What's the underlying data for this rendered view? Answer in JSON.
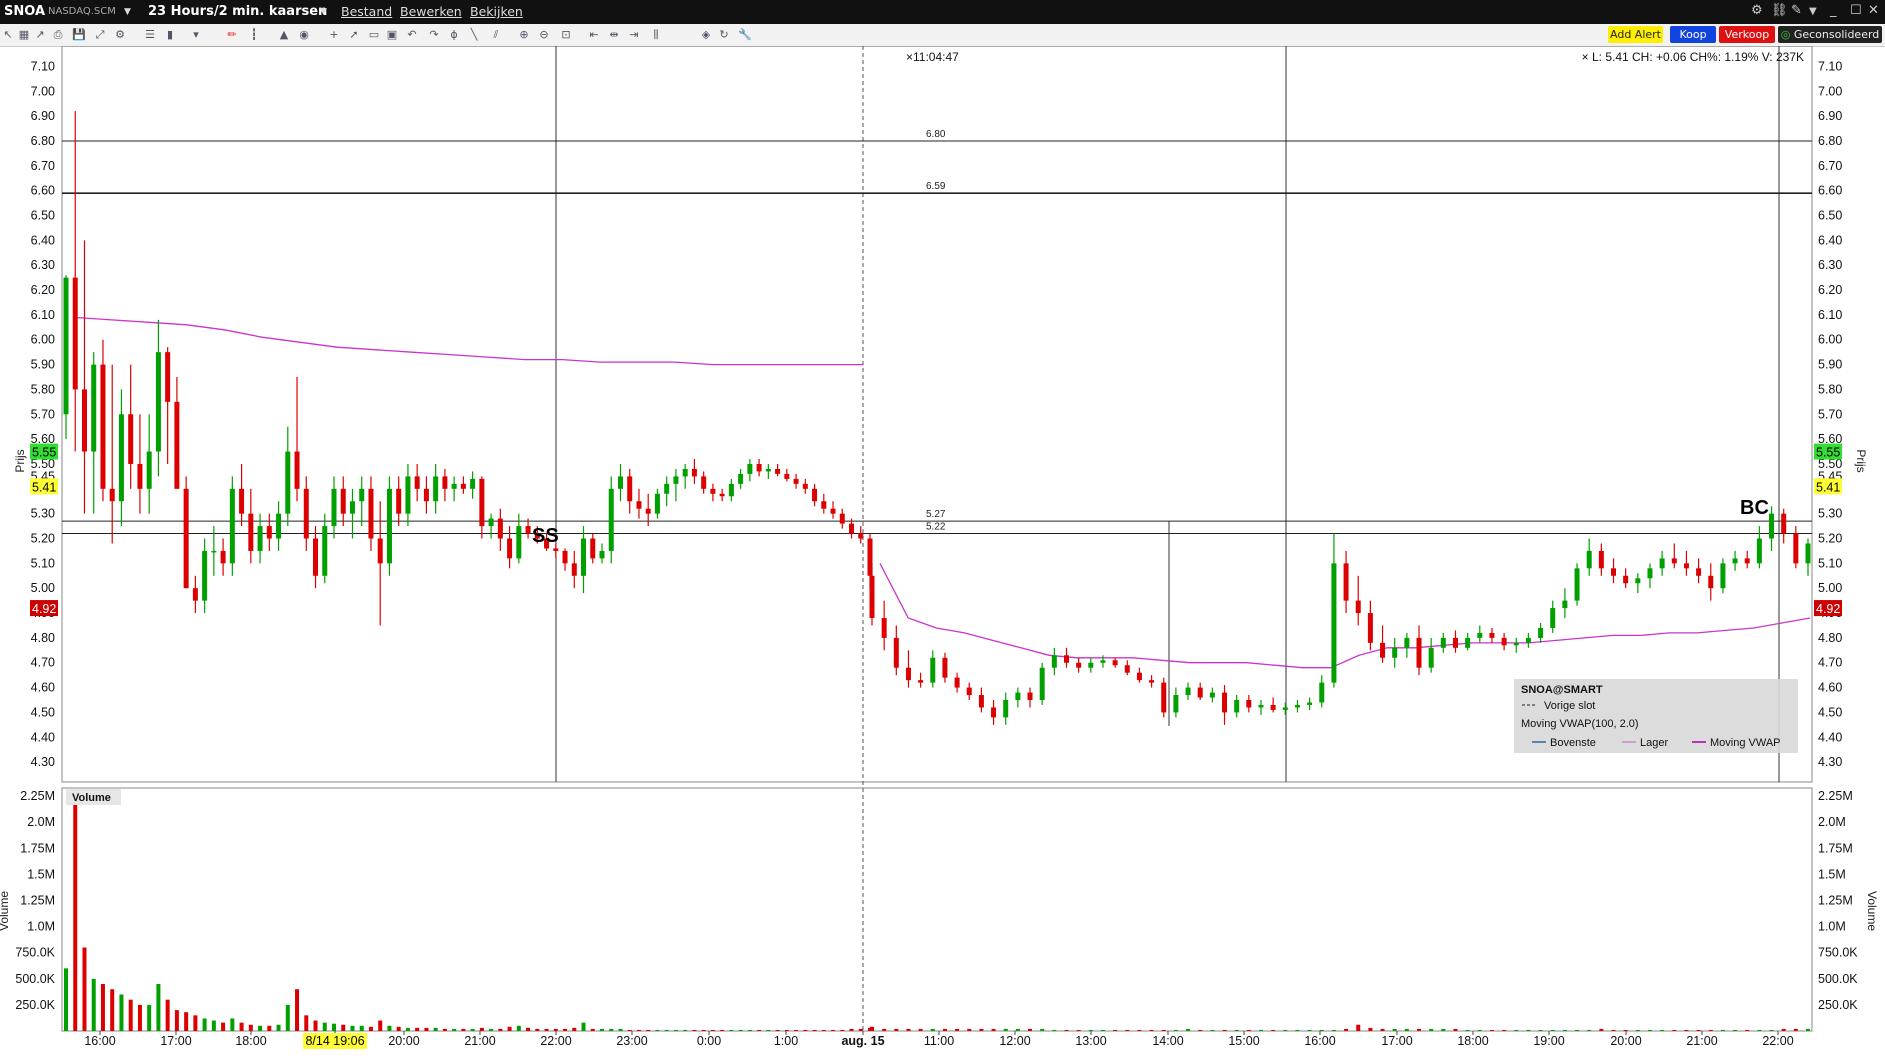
{
  "titlebar": {
    "symbol": "SNOA",
    "exchange": "NASDAQ.SCM",
    "timeframe": "23 Hours/2 min. kaarsen",
    "menu": [
      "Bestand",
      "Bewerken",
      "Bekijken"
    ],
    "window_icons": [
      "gear-icon",
      "link-icon",
      "pin-icon",
      "dropdown-icon",
      "minimize-icon",
      "maximize-icon",
      "close-icon"
    ]
  },
  "toolbar": {
    "icons": [
      "arrow-icon",
      "grid-icon",
      "pointer-icon",
      "print-icon",
      "save-icon",
      "zoom-fit-icon",
      "settings-icon",
      "list-icon",
      "bar-type-icon",
      "more-icon",
      "pencil-icon",
      "ohlc-icon",
      "area-icon",
      "globe-icon",
      "crosshair-icon",
      "cursor-icon",
      "box-icon",
      "chart-icon",
      "undo-icon",
      "redo-icon",
      "fib-icon",
      "line-icon",
      "channel-icon",
      "zoom-in-icon",
      "zoom-out-icon",
      "reset-icon",
      "scroll-left-icon",
      "scroll-center-icon",
      "scroll-right-icon",
      "split-icon",
      "shield-icon",
      "refresh-icon",
      "wrench-icon"
    ],
    "add_alert": "Add Alert",
    "buy": "Koop",
    "sell": "Verkoop",
    "consolidated": "Geconsolideerd"
  },
  "colors": {
    "up": "#00a000",
    "down": "#dd0000",
    "vwap": "#cc33cc",
    "last_price_badge": "#ffff33",
    "bid_badge": "#33dd33",
    "prev_close_badge": "#cc0000",
    "add_alert_bg": "#ffee00",
    "buy_bg": "#1144dd",
    "sell_bg": "#dd1111"
  },
  "chart_data": {
    "type": "candlestick",
    "symbol": "SNOA",
    "interval": "2 min",
    "price_axis": {
      "label": "Prijs",
      "ticks": [
        "4.30",
        "4.40",
        "4.50",
        "4.60",
        "4.70",
        "4.80",
        "4.90",
        "5.00",
        "5.10",
        "5.20",
        "5.30",
        "5.40",
        "5.45",
        "5.50",
        "5.60",
        "5.70",
        "5.80",
        "5.90",
        "6.00",
        "6.10",
        "6.20",
        "6.30",
        "6.40",
        "6.50",
        "6.60",
        "6.70",
        "6.80",
        "6.90",
        "7.00",
        "7.10"
      ],
      "range": [
        4.22,
        7.15
      ]
    },
    "volume_axis": {
      "label": "Volume",
      "ticks": [
        "250.0K",
        "500.0K",
        "750.0K",
        "1.0M",
        "1.25M",
        "1.5M",
        "1.75M",
        "2.0M",
        "2.25M"
      ],
      "range": [
        0,
        2.27
      ]
    },
    "time_axis": [
      "16:00",
      "17:00",
      "18:00",
      "19:06",
      "20:00",
      "21:00",
      "22:00",
      "23:00",
      "0:00",
      "1:00",
      "aug. 15",
      "11:00",
      "12:00",
      "13:00",
      "14:00",
      "15:00",
      "16:00",
      "17:00",
      "18:00",
      "19:00",
      "20:00",
      "21:00",
      "22:00"
    ],
    "crosshair_time_label": "8/14 19:06",
    "crosshair_clock": "11:04:47",
    "quote_header": "L: 5.41 CH: +0.06 CH%: 1.19% V: 237K",
    "price_badges": [
      {
        "price": 5.55,
        "text": "5.55",
        "color": "#33dd33"
      },
      {
        "price": 5.45,
        "text": "5.45",
        "color": "none"
      },
      {
        "price": 5.41,
        "text": "5.41",
        "color": "#ffff33"
      },
      {
        "price": 4.92,
        "text": "4.92",
        "color": "#cc0000"
      }
    ],
    "horizontal_lines": [
      {
        "price": 6.8,
        "label": "6.80"
      },
      {
        "price": 6.59,
        "label": "6.59"
      },
      {
        "price": 5.27,
        "label": "5.27"
      },
      {
        "price": 5.22,
        "label": "5.22"
      }
    ],
    "annotations": [
      {
        "text": "SS",
        "price": 5.22
      },
      {
        "text": "BC",
        "price": 5.33
      }
    ],
    "legend": {
      "title": "SNOA@SMART",
      "prev_close": "Vorige slot",
      "indicator": "Moving VWAP(100, 2.0)",
      "entries": [
        "Bovenste",
        "Lager",
        "Moving VWAP"
      ],
      "placement": "bottom-right"
    },
    "volume_panel_title": "Volume",
    "candles": [
      [
        5.7,
        6.26,
        5.6,
        6.25
      ],
      [
        6.25,
        6.92,
        5.55,
        5.8
      ],
      [
        5.8,
        6.4,
        5.3,
        5.55
      ],
      [
        5.55,
        5.95,
        5.3,
        5.9
      ],
      [
        5.9,
        6.0,
        5.35,
        5.4
      ],
      [
        5.4,
        5.9,
        5.18,
        5.35
      ],
      [
        5.35,
        5.8,
        5.25,
        5.7
      ],
      [
        5.7,
        5.9,
        5.4,
        5.5
      ],
      [
        5.5,
        5.7,
        5.3,
        5.4
      ],
      [
        5.4,
        5.7,
        5.3,
        5.55
      ],
      [
        5.55,
        6.08,
        5.45,
        5.95
      ],
      [
        5.95,
        5.97,
        5.5,
        5.75
      ],
      [
        5.75,
        5.85,
        5.4,
        5.4
      ],
      [
        5.4,
        5.45,
        5.0,
        5.0
      ],
      [
        5.0,
        5.05,
        4.9,
        4.95
      ],
      [
        4.95,
        5.2,
        4.9,
        5.15
      ],
      [
        5.15,
        5.25,
        5.05,
        5.15
      ],
      [
        5.15,
        5.2,
        5.05,
        5.1
      ],
      [
        5.1,
        5.45,
        5.05,
        5.4
      ],
      [
        5.4,
        5.5,
        5.25,
        5.3
      ],
      [
        5.3,
        5.4,
        5.1,
        5.15
      ],
      [
        5.15,
        5.3,
        5.1,
        5.25
      ],
      [
        5.25,
        5.3,
        5.15,
        5.2
      ],
      [
        5.2,
        5.35,
        5.15,
        5.3
      ],
      [
        5.3,
        5.65,
        5.25,
        5.55
      ],
      [
        5.55,
        5.85,
        5.35,
        5.4
      ],
      [
        5.4,
        5.45,
        5.15,
        5.2
      ],
      [
        5.2,
        5.25,
        5.0,
        5.05
      ],
      [
        5.05,
        5.3,
        5.02,
        5.25
      ],
      [
        5.25,
        5.45,
        5.2,
        5.4
      ],
      [
        5.4,
        5.45,
        5.25,
        5.3
      ],
      [
        5.3,
        5.4,
        5.2,
        5.35
      ],
      [
        5.35,
        5.45,
        5.25,
        5.4
      ],
      [
        5.4,
        5.45,
        5.15,
        5.2
      ],
      [
        5.2,
        5.35,
        4.85,
        5.1
      ],
      [
        5.1,
        5.45,
        5.05,
        5.4
      ],
      [
        5.4,
        5.45,
        5.25,
        5.3
      ],
      [
        5.3,
        5.5,
        5.25,
        5.45
      ],
      [
        5.45,
        5.5,
        5.35,
        5.4
      ],
      [
        5.4,
        5.45,
        5.3,
        5.35
      ],
      [
        5.35,
        5.5,
        5.3,
        5.45
      ],
      [
        5.45,
        5.48,
        5.35,
        5.4
      ],
      [
        5.4,
        5.45,
        5.35,
        5.42
      ],
      [
        5.42,
        5.45,
        5.38,
        5.4
      ],
      [
        5.4,
        5.47,
        5.36,
        5.44
      ],
      [
        5.44,
        5.45,
        5.2,
        5.25
      ],
      [
        5.25,
        5.3,
        5.2,
        5.28
      ],
      [
        5.28,
        5.32,
        5.15,
        5.2
      ],
      [
        5.2,
        5.25,
        5.08,
        5.12
      ],
      [
        5.12,
        5.3,
        5.1,
        5.25
      ],
      [
        5.25,
        5.28,
        5.2,
        5.22
      ],
      [
        5.22,
        5.25,
        5.18,
        5.2
      ],
      [
        5.2,
        5.22,
        5.15,
        5.16
      ],
      [
        5.16,
        5.18,
        5.12,
        5.15
      ],
      [
        5.15,
        5.16,
        5.07,
        5.1
      ],
      [
        5.1,
        5.15,
        5.0,
        5.05
      ],
      [
        5.05,
        5.25,
        4.98,
        5.2
      ],
      [
        5.2,
        5.22,
        5.1,
        5.12
      ],
      [
        5.12,
        5.18,
        5.1,
        5.15
      ],
      [
        5.15,
        5.45,
        5.1,
        5.4
      ],
      [
        5.4,
        5.5,
        5.35,
        5.45
      ],
      [
        5.45,
        5.48,
        5.3,
        5.35
      ],
      [
        5.35,
        5.4,
        5.28,
        5.32
      ],
      [
        5.32,
        5.38,
        5.25,
        5.3
      ],
      [
        5.3,
        5.4,
        5.28,
        5.38
      ],
      [
        5.38,
        5.45,
        5.33,
        5.42
      ],
      [
        5.42,
        5.48,
        5.35,
        5.45
      ],
      [
        5.45,
        5.5,
        5.4,
        5.48
      ],
      [
        5.48,
        5.52,
        5.42,
        5.45
      ],
      [
        5.45,
        5.47,
        5.38,
        5.4
      ],
      [
        5.4,
        5.42,
        5.35,
        5.38
      ],
      [
        5.38,
        5.4,
        5.35,
        5.37
      ],
      [
        5.37,
        5.44,
        5.35,
        5.42
      ],
      [
        5.42,
        5.48,
        5.4,
        5.46
      ],
      [
        5.46,
        5.52,
        5.43,
        5.5
      ],
      [
        5.5,
        5.52,
        5.45,
        5.47
      ],
      [
        5.47,
        5.5,
        5.44,
        5.48
      ],
      [
        5.48,
        5.5,
        5.45,
        5.46
      ],
      [
        5.46,
        5.48,
        5.43,
        5.44
      ],
      [
        5.44,
        5.46,
        5.4,
        5.42
      ],
      [
        5.42,
        5.44,
        5.38,
        5.4
      ],
      [
        5.4,
        5.42,
        5.33,
        5.35
      ],
      [
        5.35,
        5.38,
        5.3,
        5.32
      ],
      [
        5.32,
        5.35,
        5.28,
        5.3
      ],
      [
        5.3,
        5.32,
        5.24,
        5.26
      ],
      [
        5.26,
        5.28,
        5.2,
        5.22
      ],
      [
        5.22,
        5.25,
        5.18,
        5.2
      ],
      [
        5.2,
        5.22,
        5.0,
        5.05
      ],
      [
        5.05,
        5.1,
        4.85,
        4.88
      ],
      [
        4.88,
        4.95,
        4.75,
        4.8
      ],
      [
        4.8,
        4.85,
        4.65,
        4.68
      ],
      [
        4.68,
        4.75,
        4.6,
        4.63
      ],
      [
        4.63,
        4.66,
        4.6,
        4.62
      ],
      [
        4.62,
        4.75,
        4.6,
        4.72
      ],
      [
        4.72,
        4.74,
        4.62,
        4.64
      ],
      [
        4.64,
        4.66,
        4.58,
        4.6
      ],
      [
        4.6,
        4.62,
        4.55,
        4.57
      ],
      [
        4.57,
        4.6,
        4.5,
        4.52
      ],
      [
        4.52,
        4.55,
        4.45,
        4.48
      ],
      [
        4.48,
        4.58,
        4.45,
        4.55
      ],
      [
        4.55,
        4.6,
        4.52,
        4.58
      ],
      [
        4.58,
        4.6,
        4.52,
        4.55
      ],
      [
        4.55,
        4.7,
        4.53,
        4.68
      ],
      [
        4.68,
        4.76,
        4.65,
        4.73
      ],
      [
        4.73,
        4.76,
        4.68,
        4.7
      ],
      [
        4.7,
        4.72,
        4.66,
        4.68
      ],
      [
        4.68,
        4.72,
        4.66,
        4.7
      ],
      [
        4.7,
        4.73,
        4.68,
        4.71
      ],
      [
        4.71,
        4.72,
        4.68,
        4.69
      ],
      [
        4.69,
        4.71,
        4.65,
        4.66
      ],
      [
        4.66,
        4.68,
        4.62,
        4.63
      ],
      [
        4.63,
        4.65,
        4.6,
        4.62
      ],
      [
        4.62,
        4.64,
        4.48,
        4.5
      ],
      [
        4.5,
        4.6,
        4.48,
        4.57
      ],
      [
        4.57,
        4.62,
        4.55,
        4.6
      ],
      [
        4.6,
        4.62,
        4.55,
        4.56
      ],
      [
        4.56,
        4.6,
        4.54,
        4.58
      ],
      [
        4.58,
        4.61,
        4.45,
        4.5
      ],
      [
        4.5,
        4.57,
        4.48,
        4.55
      ],
      [
        4.55,
        4.57,
        4.5,
        4.52
      ],
      [
        4.52,
        4.55,
        4.49,
        4.53
      ],
      [
        4.53,
        4.56,
        4.5,
        4.51
      ],
      [
        4.51,
        4.54,
        4.49,
        4.52
      ],
      [
        4.52,
        4.55,
        4.5,
        4.53
      ],
      [
        4.53,
        4.56,
        4.51,
        4.54
      ],
      [
        4.54,
        4.65,
        4.52,
        4.62
      ],
      [
        4.62,
        5.22,
        4.6,
        5.1
      ],
      [
        5.1,
        5.15,
        4.9,
        4.95
      ],
      [
        4.95,
        5.05,
        4.85,
        4.9
      ],
      [
        4.9,
        4.95,
        4.75,
        4.78
      ],
      [
        4.78,
        4.85,
        4.7,
        4.72
      ],
      [
        4.72,
        4.8,
        4.68,
        4.76
      ],
      [
        4.76,
        4.82,
        4.72,
        4.8
      ],
      [
        4.8,
        4.85,
        4.65,
        4.68
      ],
      [
        4.68,
        4.8,
        4.66,
        4.76
      ],
      [
        4.76,
        4.82,
        4.74,
        4.8
      ],
      [
        4.8,
        4.83,
        4.74,
        4.76
      ],
      [
        4.76,
        4.82,
        4.75,
        4.8
      ],
      [
        4.8,
        4.85,
        4.78,
        4.82
      ],
      [
        4.82,
        4.84,
        4.78,
        4.8
      ],
      [
        4.8,
        4.82,
        4.75,
        4.77
      ],
      [
        4.77,
        4.8,
        4.74,
        4.78
      ],
      [
        4.78,
        4.82,
        4.76,
        4.8
      ],
      [
        4.8,
        4.86,
        4.78,
        4.84
      ],
      [
        4.84,
        4.95,
        4.82,
        4.92
      ],
      [
        4.92,
        5.0,
        4.88,
        4.95
      ],
      [
        4.95,
        5.1,
        4.93,
        5.08
      ],
      [
        5.08,
        5.2,
        5.05,
        5.15
      ],
      [
        5.15,
        5.18,
        5.05,
        5.08
      ],
      [
        5.08,
        5.12,
        5.02,
        5.05
      ],
      [
        5.05,
        5.08,
        5.0,
        5.02
      ],
      [
        5.02,
        5.06,
        4.98,
        5.04
      ],
      [
        5.04,
        5.1,
        5.0,
        5.08
      ],
      [
        5.08,
        5.15,
        5.05,
        5.12
      ],
      [
        5.12,
        5.18,
        5.08,
        5.1
      ],
      [
        5.1,
        5.15,
        5.05,
        5.08
      ],
      [
        5.08,
        5.12,
        5.02,
        5.05
      ],
      [
        5.05,
        5.1,
        4.95,
        5.0
      ],
      [
        5.0,
        5.12,
        4.98,
        5.1
      ],
      [
        5.1,
        5.15,
        5.07,
        5.12
      ],
      [
        5.12,
        5.15,
        5.08,
        5.1
      ],
      [
        5.1,
        5.25,
        5.08,
        5.2
      ],
      [
        5.2,
        5.33,
        5.15,
        5.3
      ],
      [
        5.3,
        5.32,
        5.18,
        5.22
      ],
      [
        5.22,
        5.25,
        5.08,
        5.1
      ],
      [
        5.1,
        5.2,
        5.05,
        5.18
      ]
    ],
    "volumes": [
      0.6,
      2.2,
      0.8,
      0.5,
      0.45,
      0.4,
      0.35,
      0.3,
      0.25,
      0.25,
      0.45,
      0.3,
      0.2,
      0.18,
      0.15,
      0.12,
      0.1,
      0.08,
      0.12,
      0.08,
      0.06,
      0.05,
      0.05,
      0.06,
      0.25,
      0.4,
      0.15,
      0.1,
      0.08,
      0.07,
      0.06,
      0.05,
      0.05,
      0.04,
      0.1,
      0.05,
      0.04,
      0.03,
      0.03,
      0.03,
      0.03,
      0.02,
      0.02,
      0.02,
      0.02,
      0.03,
      0.02,
      0.02,
      0.04,
      0.05,
      0.03,
      0.02,
      0.02,
      0.02,
      0.02,
      0.03,
      0.08,
      0.02,
      0.02,
      0.02,
      0.02,
      0.01,
      0.01,
      0.01,
      0.01,
      0.01,
      0.01,
      0.01,
      0.01,
      0.01,
      0.01,
      0.01,
      0.01,
      0.01,
      0.01,
      0.01,
      0.01,
      0.01,
      0.01,
      0.01,
      0.01,
      0.01,
      0.01,
      0.01,
      0.01,
      0.02,
      0.02,
      0.03,
      0.04,
      0.02,
      0.02,
      0.02,
      0.02,
      0.02,
      0.02,
      0.02,
      0.02,
      0.02,
      0.02,
      0.02,
      0.02,
      0.02,
      0.02,
      0.01,
      0.01,
      0.01,
      0.01,
      0.01,
      0.01,
      0.01,
      0.01,
      0.01,
      0.01,
      0.01,
      0.02,
      0.01,
      0.01,
      0.01,
      0.01,
      0.01,
      0.01,
      0.01,
      0.01,
      0.01,
      0.01,
      0.01,
      0.01,
      0.02,
      0.06,
      0.03,
      0.02,
      0.02,
      0.02,
      0.02,
      0.02,
      0.02,
      0.02,
      0.01,
      0.01,
      0.01,
      0.01,
      0.01,
      0.01,
      0.01,
      0.01,
      0.01,
      0.01,
      0.01,
      0.02,
      0.01,
      0.01,
      0.01,
      0.01,
      0.01,
      0.01,
      0.01,
      0.01,
      0.01,
      0.01,
      0.01,
      0.01,
      0.01,
      0.01,
      0.02,
      0.02,
      0.02,
      0.02
    ],
    "vwap_series": {
      "name": "Moving VWAP",
      "segment1": [
        6.09,
        6.08,
        6.07,
        6.06,
        6.04,
        6.01,
        5.99,
        5.97,
        5.96,
        5.95,
        5.94,
        5.93,
        5.92,
        5.92,
        5.91,
        5.91,
        5.91,
        5.9,
        5.9,
        5.9,
        5.9,
        5.9
      ],
      "segment2": [
        5.1,
        4.88,
        4.84,
        4.82,
        4.79,
        4.76,
        4.73,
        4.72,
        4.72,
        4.72,
        4.71,
        4.7,
        4.7,
        4.7,
        4.69,
        4.68,
        4.68,
        4.73,
        4.76,
        4.76,
        4.77,
        4.78,
        4.78,
        4.78,
        4.79,
        4.8,
        4.81,
        4.81,
        4.82,
        4.82,
        4.83,
        4.84,
        4.86,
        4.88
      ]
    }
  }
}
